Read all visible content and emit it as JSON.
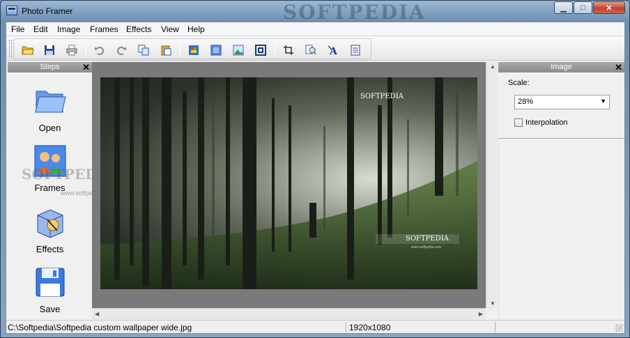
{
  "window": {
    "title": "Photo Framer",
    "background_watermark": "SOFTPEDIA",
    "controls": {
      "minimize": "▁",
      "maximize": "□",
      "close": "✕"
    }
  },
  "menu": {
    "items": [
      "File",
      "Edit",
      "Image",
      "Frames",
      "Effects",
      "View",
      "Help"
    ]
  },
  "toolbar": {
    "buttons": [
      "open-folder-icon",
      "save-disk-icon",
      "print-icon",
      "undo-icon",
      "redo-icon",
      "copy-icon",
      "paste-icon",
      "frame-color-icon",
      "frame-blue-icon",
      "image-icon",
      "frame-border-icon",
      "crop-icon",
      "zoom-icon",
      "text-icon",
      "list-icon"
    ]
  },
  "steps_panel": {
    "title": "Steps",
    "close": "✕",
    "items": [
      {
        "label": "Open",
        "icon": "folder-icon"
      },
      {
        "label": "Frames",
        "icon": "frames-people-icon"
      },
      {
        "label": "Effects",
        "icon": "effects-box-icon"
      },
      {
        "label": "Save",
        "icon": "floppy-disk-icon"
      }
    ],
    "overlay_watermark": "SOFTPEDIA",
    "overlay_small": "www.softpedia.com"
  },
  "canvas": {
    "photo_watermark_top": "SOFTPEDIA",
    "photo_watermark_bottom": "SOFTPEDIA",
    "photo_watermark_sub": "www.softpedia.com"
  },
  "image_panel": {
    "title": "Image",
    "close": "✕",
    "scale_label": "Scale:",
    "scale_value": "28%",
    "interpolation_label": "Interpolation",
    "interpolation_checked": false
  },
  "status": {
    "path": "C:\\Softpedia\\Softpedia custom wallpaper wide.jpg",
    "dimensions": "1920x1080"
  },
  "colors": {
    "title_gradient_top": "#9db8d3",
    "panel_header": "#999999",
    "canvas_bg": "#7a7a7a",
    "close_button": "#c0432c"
  }
}
